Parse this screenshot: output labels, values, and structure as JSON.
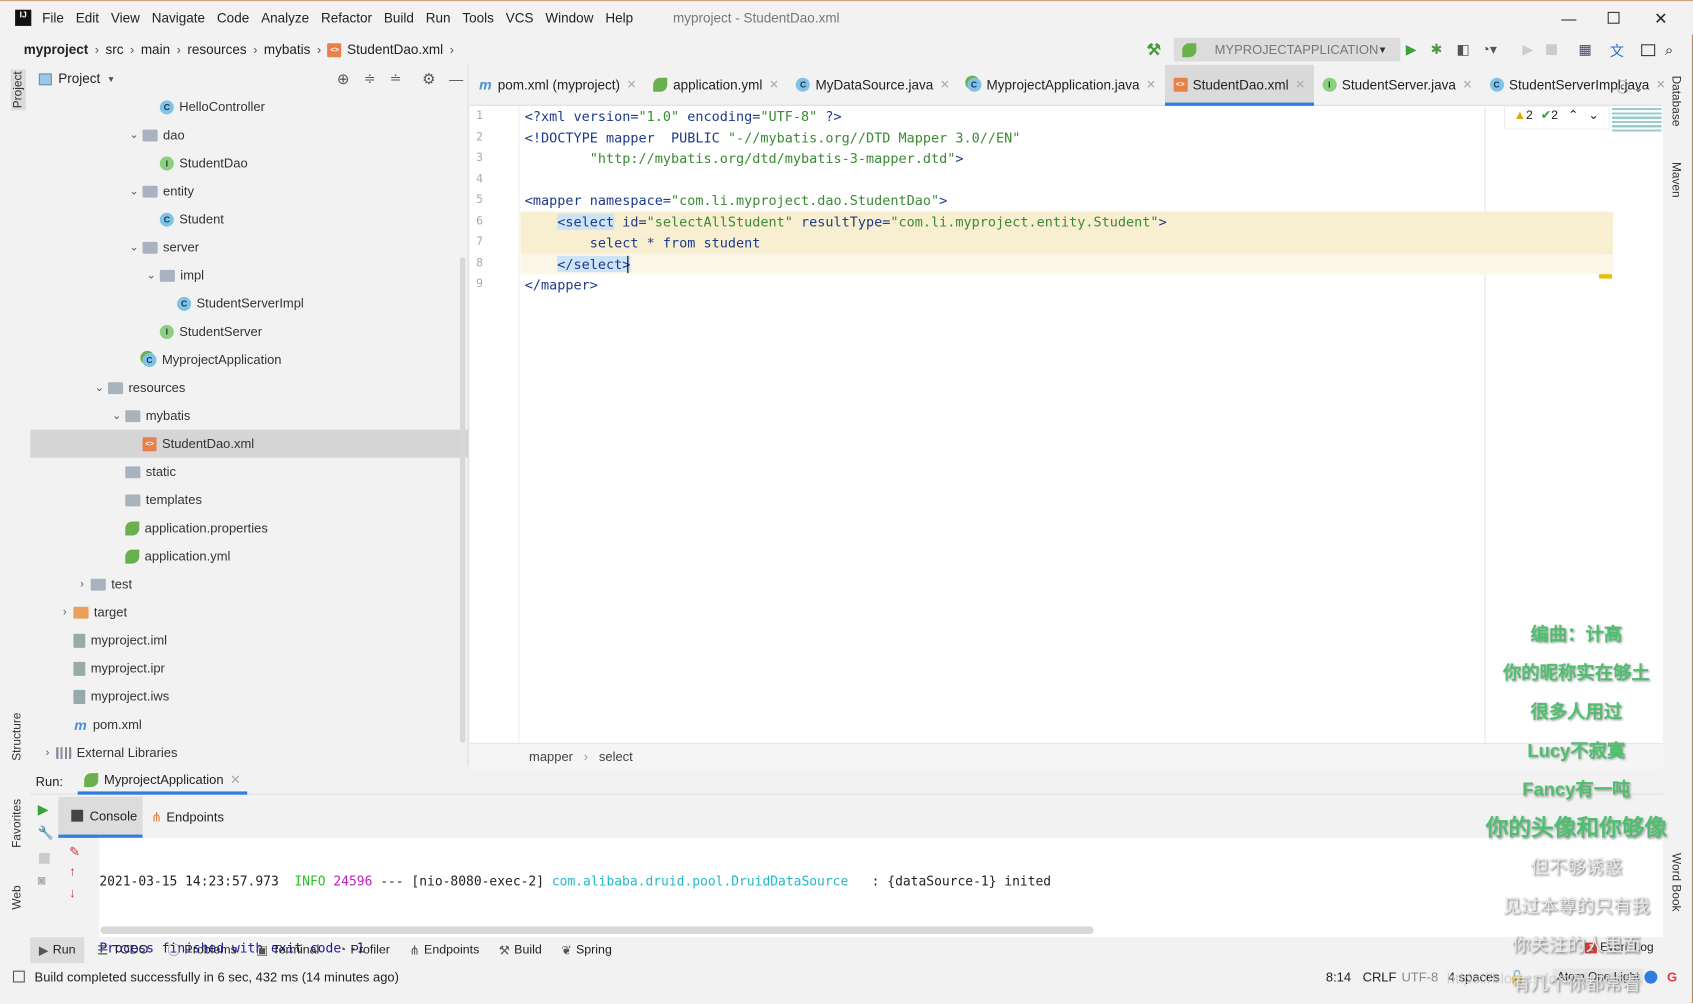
{
  "window": {
    "title": "myproject - StudentDao.xml",
    "menu": [
      "File",
      "Edit",
      "View",
      "Navigate",
      "Code",
      "Analyze",
      "Refactor",
      "Build",
      "Run",
      "Tools",
      "VCS",
      "Window",
      "Help"
    ]
  },
  "breadcrumb": [
    "myproject",
    "src",
    "main",
    "resources",
    "mybatis",
    "StudentDao.xml"
  ],
  "toolbar": {
    "run_config": "MYPROJECTAPPLICATION"
  },
  "project_panel": {
    "title": "Project",
    "tree": [
      {
        "label": "HelloController",
        "icon": "class-icon",
        "depth": 6
      },
      {
        "label": "dao",
        "icon": "folder-icon",
        "depth": 5,
        "expanded": true
      },
      {
        "label": "StudentDao",
        "icon": "interface-icon",
        "depth": 6
      },
      {
        "label": "entity",
        "icon": "folder-icon",
        "depth": 5,
        "expanded": true
      },
      {
        "label": "Student",
        "icon": "class-icon",
        "depth": 6
      },
      {
        "label": "server",
        "icon": "folder-icon",
        "depth": 5,
        "expanded": true
      },
      {
        "label": "impl",
        "icon": "folder-icon",
        "depth": 6,
        "expanded": true
      },
      {
        "label": "StudentServerImpl",
        "icon": "class-icon",
        "depth": 7
      },
      {
        "label": "StudentServer",
        "icon": "interface-icon",
        "depth": 6
      },
      {
        "label": "MyprojectApplication",
        "icon": "spring-class-icon",
        "depth": 5
      },
      {
        "label": "resources",
        "icon": "folder-icon",
        "depth": 3,
        "expanded": true
      },
      {
        "label": "mybatis",
        "icon": "folder-icon",
        "depth": 4,
        "expanded": true
      },
      {
        "label": "StudentDao.xml",
        "icon": "xml-file-icon",
        "depth": 5,
        "selected": true
      },
      {
        "label": "static",
        "icon": "folder-icon",
        "depth": 4
      },
      {
        "label": "templates",
        "icon": "folder-icon",
        "depth": 4
      },
      {
        "label": "application.properties",
        "icon": "spring-config-icon",
        "depth": 4
      },
      {
        "label": "application.yml",
        "icon": "spring-config-icon",
        "depth": 4
      },
      {
        "label": "test",
        "icon": "folder-icon",
        "depth": 2,
        "expanded": false
      },
      {
        "label": "target",
        "icon": "orange-folder-icon",
        "depth": 1,
        "expanded": false
      },
      {
        "label": "myproject.iml",
        "icon": "file-icon",
        "depth": 1
      },
      {
        "label": "myproject.ipr",
        "icon": "file-icon",
        "depth": 1
      },
      {
        "label": "myproject.iws",
        "icon": "file-icon",
        "depth": 1
      },
      {
        "label": "pom.xml",
        "icon": "maven-icon",
        "depth": 1
      },
      {
        "label": "External Libraries",
        "icon": "library-icon",
        "depth": 0,
        "expanded": false
      }
    ]
  },
  "editor": {
    "tabs": [
      {
        "label": "pom.xml (myproject)",
        "icon": "maven-icon"
      },
      {
        "label": "application.yml",
        "icon": "spring-config-icon"
      },
      {
        "label": "MyDataSource.java",
        "icon": "class-icon"
      },
      {
        "label": "MyprojectApplication.java",
        "icon": "spring-class-icon"
      },
      {
        "label": "StudentDao.xml",
        "icon": "xml-file-icon",
        "active": true
      },
      {
        "label": "StudentServer.java",
        "icon": "interface-icon"
      },
      {
        "label": "StudentServerImpl.java",
        "icon": "class-icon"
      }
    ],
    "inspections": {
      "warnings": "2",
      "weak_warnings": "2"
    },
    "lines": [
      [
        [
          "<?xml ",
          "t-tag"
        ],
        [
          "version=",
          "t-attr"
        ],
        [
          "\"1.0\"",
          "t-str"
        ],
        [
          " encoding=",
          "t-attr"
        ],
        [
          "\"UTF-8\"",
          "t-str"
        ],
        [
          " ?>",
          "t-tag"
        ]
      ],
      [
        [
          "<!DOCTYPE mapper  PUBLIC ",
          "t-tag"
        ],
        [
          "\"-//mybatis.org//DTD Mapper 3.0//EN\"",
          "t-str"
        ]
      ],
      [
        [
          "        ",
          "t-txt"
        ],
        [
          "\"http://mybatis.org/dtd/mybatis-3-mapper.dtd\"",
          "t-str"
        ],
        [
          ">",
          "t-tag"
        ]
      ],
      [],
      [
        [
          "<mapper ",
          "t-tag"
        ],
        [
          "namespace=",
          "t-attr"
        ],
        [
          "\"com.li.myproject.dao.StudentDao\"",
          "t-str"
        ],
        [
          ">",
          "t-tag"
        ]
      ],
      [
        [
          "    ",
          "t-txt"
        ],
        [
          "<select",
          "t-tag selword"
        ],
        [
          " id=",
          "t-attr"
        ],
        [
          "\"selectAllStudent\"",
          "t-str"
        ],
        [
          " resultType=",
          "t-attr"
        ],
        [
          "\"com.li.myproject.entity.Student\"",
          "t-str"
        ],
        [
          ">",
          "t-tag"
        ]
      ],
      [
        [
          "        select * from student",
          "t-kw"
        ]
      ],
      [
        [
          "    ",
          "t-txt"
        ],
        [
          "</select>",
          "t-tag selword"
        ]
      ],
      [
        [
          "</mapper>",
          "t-tag"
        ]
      ]
    ],
    "line_numbers": [
      "1",
      "2",
      "3",
      "4",
      "5",
      "6",
      "7",
      "8",
      "9"
    ],
    "breadcrumb": [
      "mapper",
      "select"
    ]
  },
  "run_panel": {
    "label": "Run:",
    "config": "MyprojectApplication",
    "tabs": [
      "Console",
      "Endpoints"
    ],
    "log": {
      "timestamp": "2021-03-15 14:23:57.973",
      "level": "INFO",
      "pid": "24596",
      "sep": "---",
      "thread": "[nio-8080-exec-2]",
      "logger": "com.alibaba.druid.pool.DruidDataSource",
      "message": "  : {dataSource-1} inited"
    },
    "exit": "Process finished with exit code -1"
  },
  "tool_tabs": [
    "Run",
    "TODO",
    "Problems",
    "Terminal",
    "Profiler",
    "Endpoints",
    "Build",
    "Spring"
  ],
  "event_log": {
    "label": "Event Log",
    "count": "1"
  },
  "side_labels": {
    "project": "Project",
    "structure": "Structure",
    "favorites": "Favorites",
    "web": "Web",
    "database": "Database",
    "maven": "Maven",
    "word_book": "Word Book"
  },
  "status": {
    "message": "Build completed successfully in 6 sec, 432 ms (14 minutes ago)",
    "position": "8:14",
    "line_sep": "CRLF",
    "encoding": "UTF-8",
    "indent": "4 spaces",
    "theme": "Atom One Light"
  },
  "lyrics": [
    "编曲：计高",
    "你的昵称实在够土",
    "很多人用过",
    "Lucy不寂寞",
    "Fancy有一吨",
    "你的头像和你够像",
    "但不够诱惑",
    "见过本尊的只有我",
    "你关注的人里面",
    "有几个你都常看"
  ],
  "watermark": "https://blog.csdn.net/...10882"
}
